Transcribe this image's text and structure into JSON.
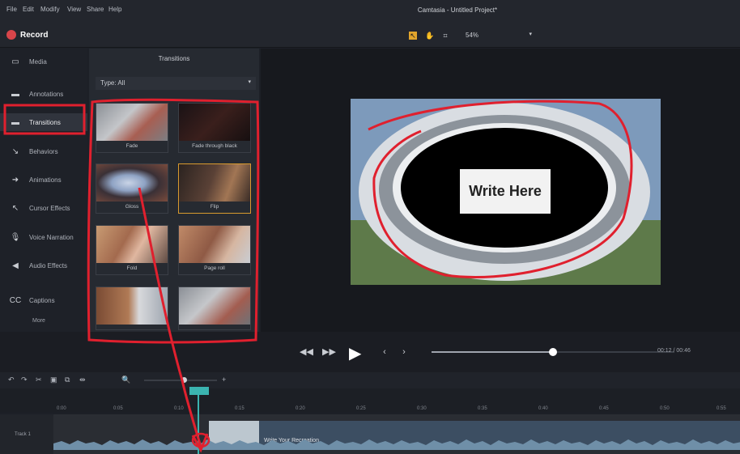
{
  "menubar": {
    "items": [
      "File",
      "Edit",
      "Modify",
      "View",
      "Share",
      "Help"
    ],
    "title": "Camtasia - Untitled Project*"
  },
  "toolbar": {
    "record_label": "Record",
    "zoom_value": "54%"
  },
  "sidebar": {
    "items": [
      {
        "label": "Media",
        "icon": "media-icon"
      },
      {
        "label": "Annotations",
        "icon": "annotations-icon"
      },
      {
        "label": "Transitions",
        "icon": "transitions-icon",
        "selected": true
      },
      {
        "label": "Behaviors",
        "icon": "behaviors-icon"
      },
      {
        "label": "Animations",
        "icon": "animations-icon"
      },
      {
        "label": "Cursor Effects",
        "icon": "cursor-effects-icon"
      },
      {
        "label": "Voice Narration",
        "icon": "voice-narration-icon"
      },
      {
        "label": "Audio Effects",
        "icon": "audio-effects-icon"
      },
      {
        "label": "Captions",
        "icon": "captions-icon"
      }
    ],
    "more_label": "More"
  },
  "transitions_panel": {
    "title": "Transitions",
    "filter_value": "Type: All",
    "items": [
      {
        "label": "Fade"
      },
      {
        "label": "Fade through black"
      },
      {
        "label": "Gloss"
      },
      {
        "label": "Flip"
      },
      {
        "label": "Fold"
      },
      {
        "label": "Page roll"
      },
      {
        "label": ""
      },
      {
        "label": ""
      }
    ]
  },
  "canvas": {
    "overlay_text": "Write Here"
  },
  "transport": {
    "progress": 0.5,
    "time_display": "00:12 / 00:46"
  },
  "timeline": {
    "track_name": "Track 1",
    "clip_title": "Write Your Recreation",
    "ruler_labels": [
      "0:00",
      "0:05",
      "0:10",
      "0:15",
      "0:20",
      "0:25",
      "0:30",
      "0:35",
      "0:40",
      "0:45",
      "0:50",
      "0:55"
    ]
  },
  "colors": {
    "accent": "#e2a52c",
    "record": "#d8454a",
    "playhead": "#3bb4b0",
    "annotation": "#e0202e"
  }
}
